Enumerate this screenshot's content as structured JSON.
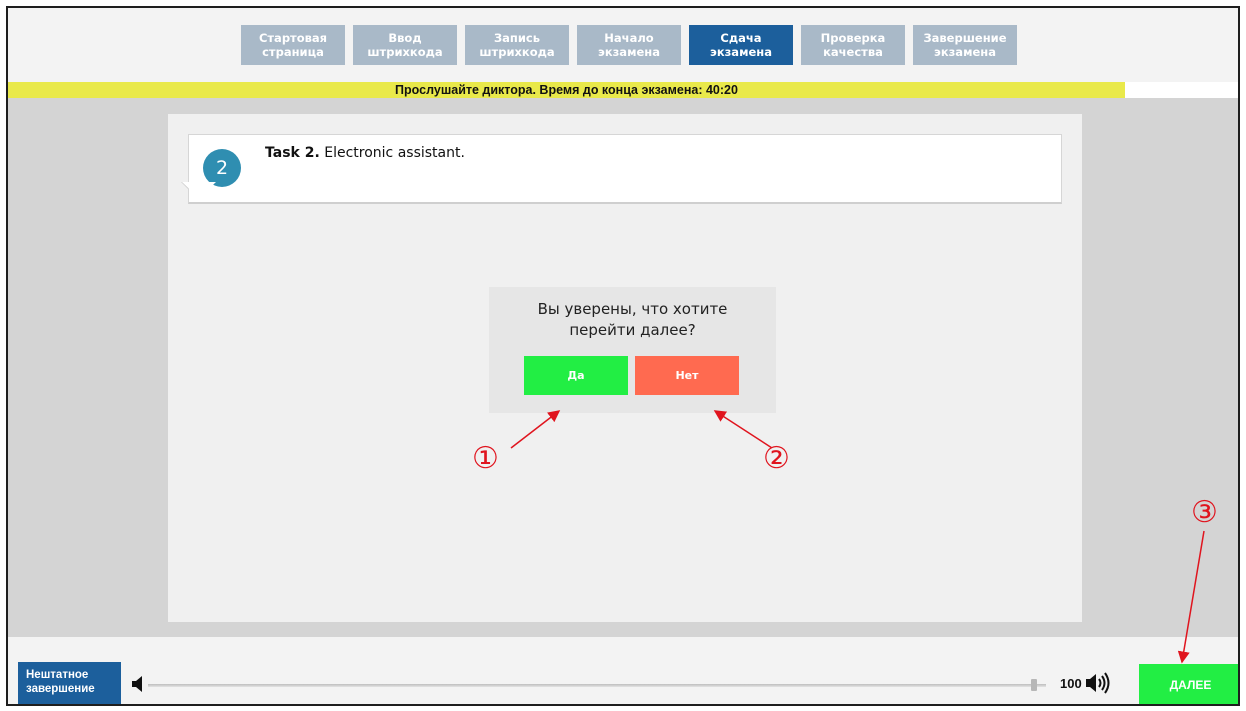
{
  "steps": [
    {
      "label": "Стартовая\nстраница",
      "active": false
    },
    {
      "label": "Ввод\nштрихкода",
      "active": false
    },
    {
      "label": "Запись\nштрихкода",
      "active": false
    },
    {
      "label": "Начало\nэкзамена",
      "active": false
    },
    {
      "label": "Сдача\nэкзамена",
      "active": true
    },
    {
      "label": "Проверка\nкачества",
      "active": false
    },
    {
      "label": "Завершение\nэкзамена",
      "active": false
    }
  ],
  "status": {
    "message": "Прослушайте диктора. Время до конца экзамена: 40:20"
  },
  "task": {
    "number": "2",
    "title_bold": "Task 2.",
    "title_rest": " Electronic assistant."
  },
  "dialog": {
    "question": "Вы уверены, что хотите\nперейти далее?",
    "yes_label": "Да",
    "no_label": "Нет"
  },
  "annotations": {
    "one": "①",
    "two": "②",
    "three": "③",
    "color": "#e0141e"
  },
  "footer": {
    "emergency_label": "Нештатное\nзавершение",
    "volume_value": "100",
    "volume_level": 0.99,
    "next_label": "ДАЛЕЕ"
  },
  "colors": {
    "step_inactive": "#a9b9c8",
    "step_active": "#1c5f9c",
    "status_bar": "#e9e94a",
    "yes": "#22ee44",
    "no": "#ff6a50",
    "next": "#22ee44"
  }
}
